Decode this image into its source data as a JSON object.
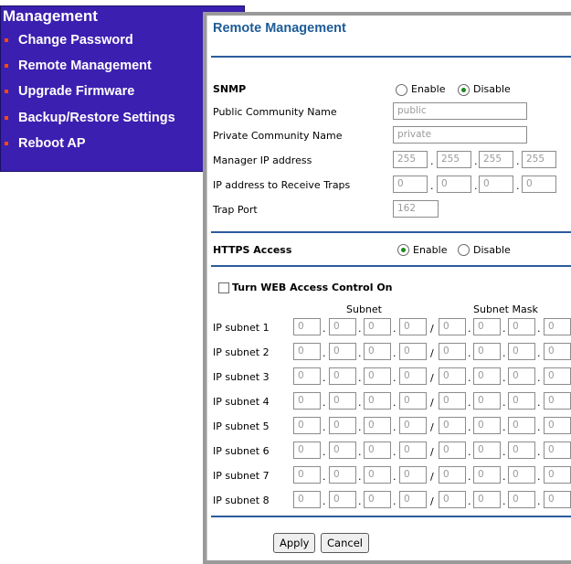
{
  "menu": {
    "title": "Management",
    "items": [
      {
        "label": "Change Password"
      },
      {
        "label": "Remote Management"
      },
      {
        "label": "Upgrade Firmware"
      },
      {
        "label": "Backup/Restore Settings"
      },
      {
        "label": "Reboot AP"
      }
    ]
  },
  "page": {
    "title": "Remote Management"
  },
  "snmp": {
    "heading": "SNMP",
    "enable_label": "Enable",
    "disable_label": "Disable",
    "selected": "Disable",
    "public_label": "Public Community Name",
    "public_value": "public",
    "private_label": "Private Community Name",
    "private_value": "private",
    "manager_label": "Manager IP address",
    "manager_octets": [
      "255",
      "255",
      "255",
      "255"
    ],
    "traps_label": "IP address to Receive Traps",
    "traps_octets": [
      "0",
      "0",
      "0",
      "0"
    ],
    "trap_port_label": "Trap Port",
    "trap_port_value": "162"
  },
  "https": {
    "heading": "HTTPS Access",
    "enable_label": "Enable",
    "disable_label": "Disable",
    "selected": "Enable"
  },
  "web_access": {
    "checkbox_label": "Turn WEB Access Control On",
    "checked": false,
    "subnet_header": "Subnet",
    "mask_header": "Subnet Mask",
    "rows": [
      {
        "label": "IP subnet 1",
        "subnet": [
          "0",
          "0",
          "0",
          "0"
        ],
        "mask": [
          "0",
          "0",
          "0",
          "0"
        ]
      },
      {
        "label": "IP subnet 2",
        "subnet": [
          "0",
          "0",
          "0",
          "0"
        ],
        "mask": [
          "0",
          "0",
          "0",
          "0"
        ]
      },
      {
        "label": "IP subnet 3",
        "subnet": [
          "0",
          "0",
          "0",
          "0"
        ],
        "mask": [
          "0",
          "0",
          "0",
          "0"
        ]
      },
      {
        "label": "IP subnet 4",
        "subnet": [
          "0",
          "0",
          "0",
          "0"
        ],
        "mask": [
          "0",
          "0",
          "0",
          "0"
        ]
      },
      {
        "label": "IP subnet 5",
        "subnet": [
          "0",
          "0",
          "0",
          "0"
        ],
        "mask": [
          "0",
          "0",
          "0",
          "0"
        ]
      },
      {
        "label": "IP subnet 6",
        "subnet": [
          "0",
          "0",
          "0",
          "0"
        ],
        "mask": [
          "0",
          "0",
          "0",
          "0"
        ]
      },
      {
        "label": "IP subnet 7",
        "subnet": [
          "0",
          "0",
          "0",
          "0"
        ],
        "mask": [
          "0",
          "0",
          "0",
          "0"
        ]
      },
      {
        "label": "IP subnet 8",
        "subnet": [
          "0",
          "0",
          "0",
          "0"
        ],
        "mask": [
          "0",
          "0",
          "0",
          "0"
        ]
      }
    ]
  },
  "buttons": {
    "apply": "Apply",
    "cancel": "Cancel"
  },
  "colors": {
    "menu_bg": "#3b1fb0",
    "title_blue": "#1d5c97",
    "rule_blue": "#2c5b9c",
    "bullet_orange": "#ff4a00"
  }
}
